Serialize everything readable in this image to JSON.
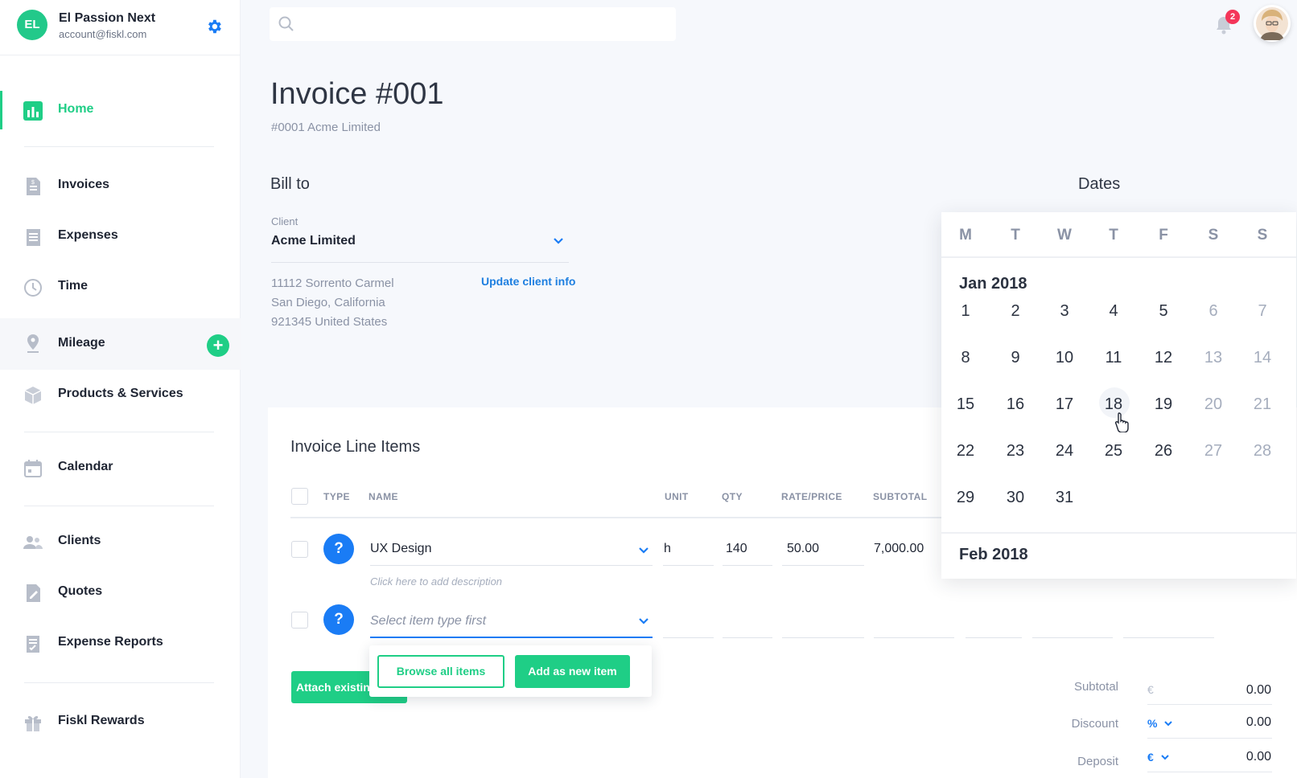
{
  "account": {
    "initials": "EL",
    "name": "El Passion Next",
    "email": "account@fiskl.com"
  },
  "sidebar": {
    "items": [
      {
        "label": "Home"
      },
      {
        "label": "Invoices"
      },
      {
        "label": "Expenses"
      },
      {
        "label": "Time"
      },
      {
        "label": "Mileage"
      },
      {
        "label": "Products & Services"
      },
      {
        "label": "Calendar"
      },
      {
        "label": "Clients"
      },
      {
        "label": "Quotes"
      },
      {
        "label": "Expense Reports"
      },
      {
        "label": "Fiskl Rewards"
      }
    ],
    "add_label": "+"
  },
  "topbar": {
    "search_placeholder": "",
    "notification_count": "2"
  },
  "invoice": {
    "title": "Invoice #001",
    "subtitle": "#0001 Acme Limited"
  },
  "bill_to": {
    "heading": "Bill to",
    "client_label": "Client",
    "client_value": "Acme Limited",
    "address": [
      "11112 Sorrento Carmel",
      "San Diego, California",
      "921345 United States"
    ],
    "update_link": "Update client info"
  },
  "dates": {
    "heading": "Dates"
  },
  "calendar": {
    "weekdays": [
      "M",
      "T",
      "W",
      "T",
      "F",
      "S",
      "S"
    ],
    "month1": "Jan 2018",
    "month2": "Feb 2018",
    "hovered_day": "18",
    "days": [
      "1",
      "2",
      "3",
      "4",
      "5",
      "6",
      "7",
      "8",
      "9",
      "10",
      "11",
      "12",
      "13",
      "14",
      "15",
      "16",
      "17",
      "18",
      "19",
      "20",
      "21",
      "22",
      "23",
      "24",
      "25",
      "26",
      "27",
      "28",
      "29",
      "30",
      "31"
    ]
  },
  "line_items": {
    "heading": "Invoice Line Items",
    "columns": {
      "type": "TYPE",
      "name": "NAME",
      "unit": "UNIT",
      "qty": "QTY",
      "rate": "RATE/PRICE",
      "subtotal": "SUBTOTAL"
    },
    "rows": [
      {
        "type_icon": "?",
        "name": "UX Design",
        "unit": "h",
        "qty": "140",
        "rate": "50.00",
        "subtotal": "7,000.00",
        "description_placeholder": "Click here to add description"
      },
      {
        "type_icon": "?",
        "name_placeholder": "Select item type first"
      }
    ],
    "attach_button": "Attach existing",
    "popover": {
      "browse": "Browse all items",
      "add_new": "Add as new item"
    }
  },
  "totals": {
    "subtotal_label": "Subtotal",
    "subtotal_currency": "€",
    "subtotal_value": "0.00",
    "discount_label": "Discount",
    "discount_unit": "%",
    "discount_value": "0.00",
    "deposit_label": "Deposit",
    "deposit_unit": "€",
    "deposit_value": "0.00"
  },
  "colors": {
    "accent_green": "#1fce86",
    "accent_blue": "#1a7cf5",
    "badge_red": "#f4365a"
  }
}
